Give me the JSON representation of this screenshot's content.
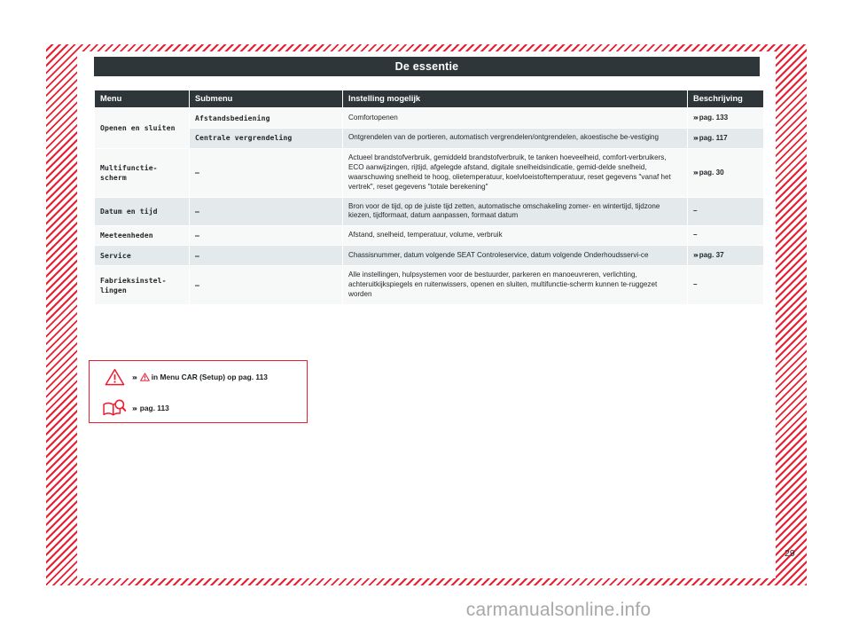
{
  "document": {
    "title": "De essentie",
    "page_number": "29",
    "watermark": "carmanualsonline.info"
  },
  "table": {
    "headers": [
      "Menu",
      "Submenu",
      "Instelling mogelijk",
      "Beschrijving"
    ],
    "rows": [
      {
        "menu": "Openen en sluiten",
        "submenu": "Afstandsbediening",
        "setting": "Comfortopenen",
        "description": "pag. 133",
        "description_has_chevron": true
      },
      {
        "menu": "",
        "submenu": "Centrale vergrendeling",
        "setting": "Ontgrendelen van de portieren, automatisch vergrendelen/ontgrendelen, akoestische be-vestiging",
        "description": "pag. 117",
        "description_has_chevron": true
      },
      {
        "menu": "Multifunctie-scherm",
        "submenu": "–",
        "setting": "Actueel brandstofverbruik, gemiddeld brandstofverbruik, te tanken hoeveelheid, comfort-verbruikers, ECO aanwijzingen, rijtijd, afgelegde afstand, digitale snelheidsindicatie, gemid-delde snelheid, waarschuwing snelheid te hoog, olietemperatuur, koelvloeistoftemperatuur, reset gegevens \"vanaf het vertrek\", reset gegevens \"totale berekening\"",
        "description": "pag. 30",
        "description_has_chevron": true
      },
      {
        "menu": "Datum en tijd",
        "submenu": "–",
        "setting": "Bron voor de tijd, op de juiste tijd zetten, automatische omschakeling zomer- en wintertijd, tijdzone kiezen, tijdformaat, datum aanpassen, formaat datum",
        "description": "–",
        "description_has_chevron": false
      },
      {
        "menu": "Meeteenheden",
        "submenu": "–",
        "setting": "Afstand, snelheid, temperatuur, volume, verbruik",
        "description": "–",
        "description_has_chevron": false
      },
      {
        "menu": "Service",
        "submenu": "–",
        "setting": "Chassisnummer, datum volgende SEAT Controleservice, datum volgende Onderhoudsservi-ce",
        "description": "pag. 37",
        "description_has_chevron": true
      },
      {
        "menu": "Fabrieksinstel-lingen",
        "submenu": "–",
        "setting": "Alle instellingen, hulpsystemen voor de bestuurder, parkeren en manoeuvreren, verlichting, achteruitkijkspiegels en ruitenwissers, openen en sluiten, multifunctie-scherm kunnen te-ruggezet worden",
        "description": "–",
        "description_has_chevron": false
      }
    ]
  },
  "note_box": {
    "rows": [
      {
        "icon": "warning-triangle-icon",
        "chevron": "›››",
        "text": "in Menu CAR (Setup) op pag. 113",
        "inline_icon": "warning-triangle-icon"
      },
      {
        "icon": "book-magnifier-icon",
        "chevron": "›››",
        "text": "pag. 113",
        "inline_icon": ""
      }
    ]
  },
  "colors": {
    "header_dark": "#2f3639",
    "accent_red": "#ed1c2e",
    "row_light": "#f7f8f8",
    "row_alt": "#e4e9eb",
    "watermark_gray": "#a8a8a8"
  }
}
